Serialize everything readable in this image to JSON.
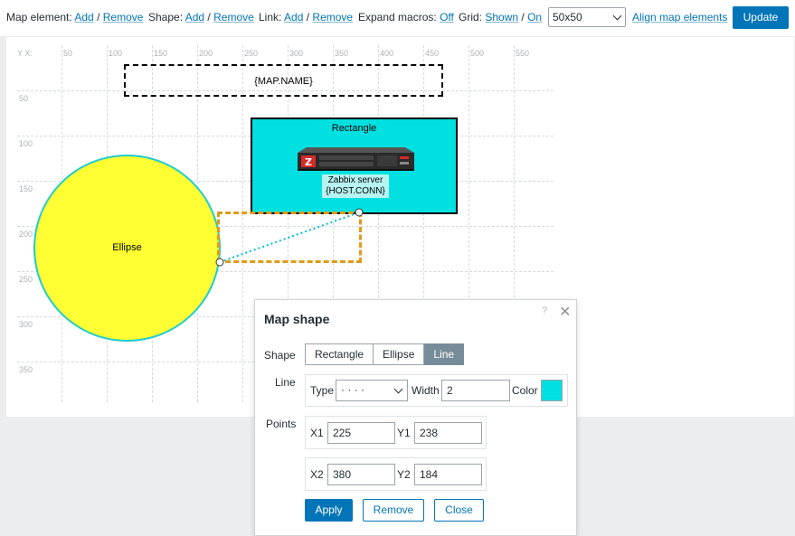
{
  "toolbar": {
    "map_element_label": "Map element:",
    "shape_label": "Shape:",
    "link_label": "Link:",
    "add": "Add",
    "remove": "Remove",
    "slash": "/",
    "expand_macros_label": "Expand macros:",
    "expand_macros_value": "Off",
    "grid_label": "Grid:",
    "grid_shown": "Shown",
    "grid_on": "On",
    "grid_size": "50x50",
    "align": "Align map elements",
    "update": "Update"
  },
  "map": {
    "axis_corner": "Y X:",
    "x_ticks": [
      "50",
      "100",
      "150",
      "200",
      "250",
      "300",
      "350",
      "400",
      "450",
      "500",
      "550"
    ],
    "y_ticks": [
      "50",
      "100",
      "150",
      "200",
      "250",
      "300",
      "350"
    ],
    "map_name": "{MAP.NAME}",
    "ellipse_label": "Ellipse",
    "rectangle_label": "Rectangle",
    "host_name": "Zabbix server",
    "host_conn": "{HOST.CONN}",
    "colors": {
      "ellipse_fill": "#ffff33",
      "ellipse_border": "#22cccc",
      "rect_fill": "#00e0e0",
      "line": "#00bcd4",
      "selection": "#e09a1a"
    }
  },
  "dialog": {
    "title": "Map shape",
    "help": "?",
    "shape_label": "Shape",
    "shape_options": [
      "Rectangle",
      "Ellipse",
      "Line"
    ],
    "shape_selected": "Line",
    "line_label": "Line",
    "type_label": "Type",
    "type_value": "· · · ·",
    "width_label": "Width",
    "width_value": "2",
    "color_label": "Color",
    "color_value": "#00e0e0",
    "points_label": "Points",
    "x1_label": "X1",
    "x1": "225",
    "y1_label": "Y1",
    "y1": "238",
    "x2_label": "X2",
    "x2": "380",
    "y2_label": "Y2",
    "y2": "184",
    "apply": "Apply",
    "remove": "Remove",
    "close": "Close"
  }
}
